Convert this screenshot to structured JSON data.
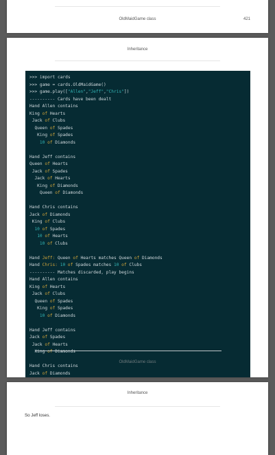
{
  "page1": {
    "footer_title": "OldMaidGame class",
    "page_number": "421"
  },
  "page2": {
    "header": "Inheritance",
    "overlay_footer": "OldMaidGame class",
    "code_lines": [
      [
        {
          "t": ">>> import cards"
        }
      ],
      [
        {
          "t": ">>> game = cards.OldMaidGame()"
        }
      ],
      [
        {
          "t": ">>> game.play(["
        },
        {
          "t": "\"Allen\"",
          "c": "s"
        },
        {
          "t": ","
        },
        {
          "t": "\"Jeff\"",
          "c": "s"
        },
        {
          "t": ","
        },
        {
          "t": "\"Chris\"",
          "c": "s"
        },
        {
          "t": "])"
        }
      ],
      [
        {
          "t": "---------- Cards have been dealt"
        }
      ],
      [
        {
          "t": "Hand Allen contains"
        }
      ],
      [
        {
          "t": "King "
        },
        {
          "t": "of",
          "c": "k"
        },
        {
          "t": " Hearts"
        }
      ],
      [
        {
          "t": " Jack "
        },
        {
          "t": "of",
          "c": "k"
        },
        {
          "t": " Clubs"
        }
      ],
      [
        {
          "t": "  Queen "
        },
        {
          "t": "of",
          "c": "k"
        },
        {
          "t": " Spades"
        }
      ],
      [
        {
          "t": "   King "
        },
        {
          "t": "of",
          "c": "k"
        },
        {
          "t": " Spades"
        }
      ],
      [
        {
          "t": "    "
        },
        {
          "t": "10",
          "c": "n"
        },
        {
          "t": " "
        },
        {
          "t": "of",
          "c": "k"
        },
        {
          "t": " Diamonds"
        }
      ],
      [
        {
          "t": ""
        }
      ],
      [
        {
          "t": "Hand Jeff contains"
        }
      ],
      [
        {
          "t": "Queen "
        },
        {
          "t": "of",
          "c": "k"
        },
        {
          "t": " Hearts"
        }
      ],
      [
        {
          "t": " Jack "
        },
        {
          "t": "of",
          "c": "k"
        },
        {
          "t": " Spades"
        }
      ],
      [
        {
          "t": "  Jack "
        },
        {
          "t": "of",
          "c": "k"
        },
        {
          "t": " Hearts"
        }
      ],
      [
        {
          "t": "   King "
        },
        {
          "t": "of",
          "c": "k"
        },
        {
          "t": " Diamonds"
        }
      ],
      [
        {
          "t": "    Queen "
        },
        {
          "t": "of",
          "c": "k"
        },
        {
          "t": " Diamonds"
        }
      ],
      [
        {
          "t": ""
        }
      ],
      [
        {
          "t": "Hand Chris contains"
        }
      ],
      [
        {
          "t": "Jack "
        },
        {
          "t": "of",
          "c": "k"
        },
        {
          "t": " Diamonds"
        }
      ],
      [
        {
          "t": " King "
        },
        {
          "t": "of",
          "c": "k"
        },
        {
          "t": " Clubs"
        }
      ],
      [
        {
          "t": "  "
        },
        {
          "t": "10",
          "c": "n"
        },
        {
          "t": " "
        },
        {
          "t": "of",
          "c": "k"
        },
        {
          "t": " Spades"
        }
      ],
      [
        {
          "t": "   "
        },
        {
          "t": "10",
          "c": "n"
        },
        {
          "t": " "
        },
        {
          "t": "of",
          "c": "k"
        },
        {
          "t": " Hearts"
        }
      ],
      [
        {
          "t": "    "
        },
        {
          "t": "10",
          "c": "n"
        },
        {
          "t": " "
        },
        {
          "t": "of",
          "c": "k"
        },
        {
          "t": " Clubs"
        }
      ],
      [
        {
          "t": ""
        }
      ],
      [
        {
          "t": "Hand "
        },
        {
          "t": "Jeff:",
          "c": "k"
        },
        {
          "t": " Queen "
        },
        {
          "t": "of",
          "c": "k"
        },
        {
          "t": " Hearts matches Queen "
        },
        {
          "t": "of",
          "c": "k"
        },
        {
          "t": " Diamonds"
        }
      ],
      [
        {
          "t": "Hand "
        },
        {
          "t": "Chris:",
          "c": "k"
        },
        {
          "t": " "
        },
        {
          "t": "10",
          "c": "n"
        },
        {
          "t": " "
        },
        {
          "t": "of",
          "c": "k"
        },
        {
          "t": " Spades matches "
        },
        {
          "t": "10",
          "c": "n"
        },
        {
          "t": " "
        },
        {
          "t": "of",
          "c": "k"
        },
        {
          "t": " Clubs"
        }
      ],
      [
        {
          "t": "---------- Matches discarded, play begins"
        }
      ],
      [
        {
          "t": "Hand Allen contains"
        }
      ],
      [
        {
          "t": "King "
        },
        {
          "t": "of",
          "c": "k"
        },
        {
          "t": " Hearts"
        }
      ],
      [
        {
          "t": " Jack "
        },
        {
          "t": "of",
          "c": "k"
        },
        {
          "t": " Clubs"
        }
      ],
      [
        {
          "t": "  Queen "
        },
        {
          "t": "of",
          "c": "k"
        },
        {
          "t": " Spades"
        }
      ],
      [
        {
          "t": "   King "
        },
        {
          "t": "of",
          "c": "k"
        },
        {
          "t": " Spades"
        }
      ],
      [
        {
          "t": "    "
        },
        {
          "t": "10",
          "c": "n"
        },
        {
          "t": " "
        },
        {
          "t": "of",
          "c": "k"
        },
        {
          "t": " Diamonds"
        }
      ],
      [
        {
          "t": ""
        }
      ],
      [
        {
          "t": "Hand Jeff contains"
        }
      ],
      [
        {
          "t": "Jack "
        },
        {
          "t": "of",
          "c": "k"
        },
        {
          "t": " Spades"
        }
      ],
      [
        {
          "t": " Jack "
        },
        {
          "t": "of",
          "c": "k"
        },
        {
          "t": " Hearts"
        }
      ],
      [
        {
          "t": "  King "
        },
        {
          "t": "of",
          "c": "k"
        },
        {
          "t": " Diamonds"
        }
      ],
      [
        {
          "t": ""
        }
      ],
      [
        {
          "t": "Hand Chris contains"
        }
      ],
      [
        {
          "t": "Jack "
        },
        {
          "t": "of",
          "c": "k"
        },
        {
          "t": " Diamonds"
        }
      ]
    ]
  },
  "page3": {
    "header": "Inheritance",
    "body_text": "So Jeff loses."
  }
}
